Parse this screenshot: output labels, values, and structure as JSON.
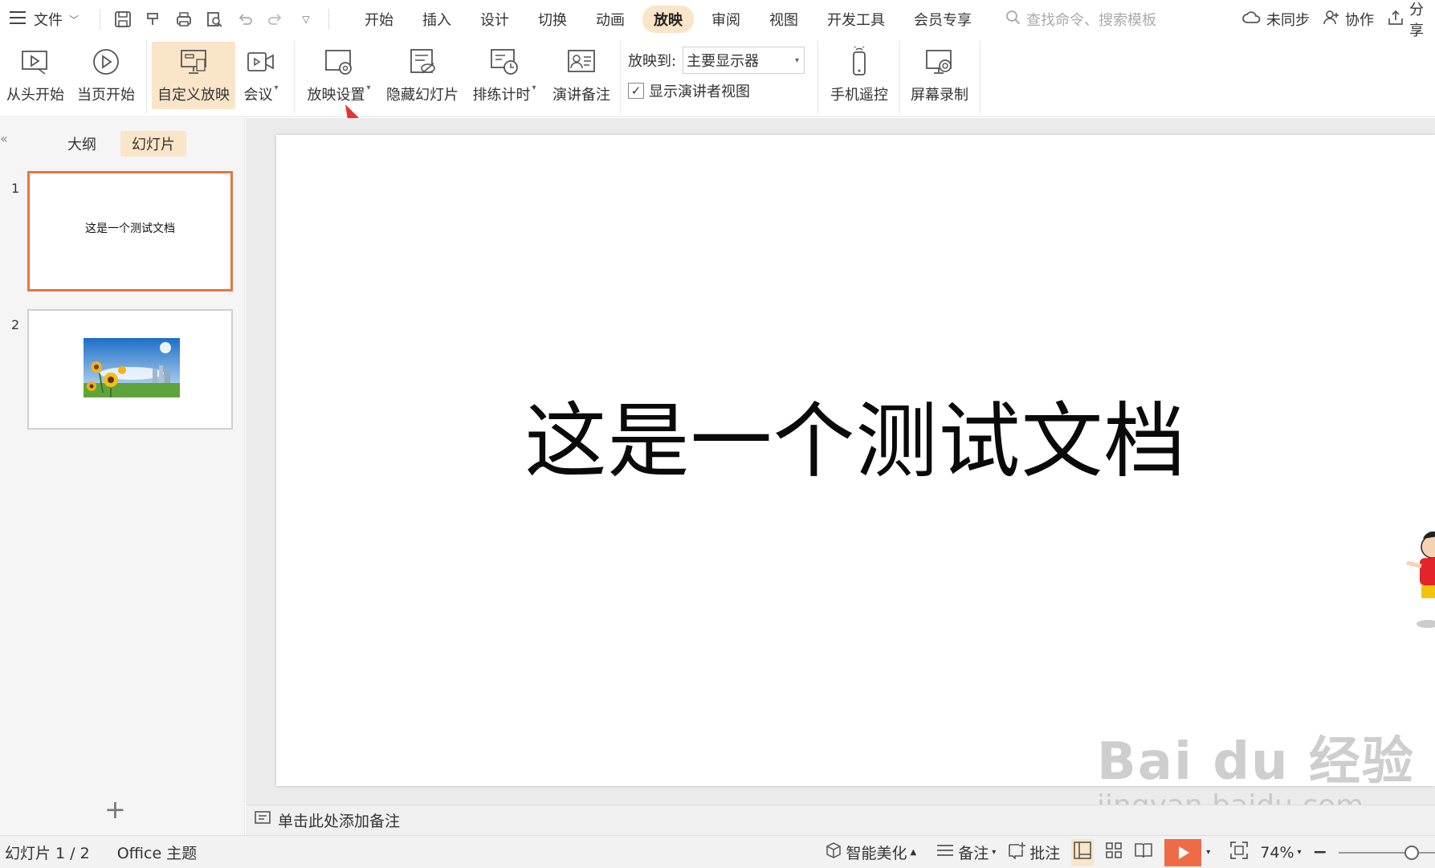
{
  "menubar": {
    "file_label": "文件",
    "tabs": [
      {
        "label": "开始"
      },
      {
        "label": "插入"
      },
      {
        "label": "设计"
      },
      {
        "label": "切换"
      },
      {
        "label": "动画"
      },
      {
        "label": "放映",
        "active": true
      },
      {
        "label": "审阅"
      },
      {
        "label": "视图"
      },
      {
        "label": "开发工具"
      },
      {
        "label": "会员专享"
      }
    ],
    "search_placeholder": "查找命令、搜索模板",
    "sync_label": "未同步",
    "collab_label": "协作",
    "share_label": "分享"
  },
  "ribbon": {
    "from_start": "从头开始",
    "from_current": "当页开始",
    "custom_show": "自定义放映",
    "meeting": "会议",
    "show_settings": "放映设置",
    "hide_slide": "隐藏幻灯片",
    "rehearse": "排练计时",
    "speaker_notes": "演讲备注",
    "play_to_label": "放映到:",
    "play_to_value": "主要显示器",
    "presenter_view_label": "显示演讲者视图",
    "presenter_view_checked": true,
    "remote": "手机遥控",
    "screen_record": "屏幕录制"
  },
  "leftpanel": {
    "tab_outline": "大纲",
    "tab_slides": "幻灯片",
    "slides": [
      {
        "number": "1",
        "text": "这是一个测试文档",
        "selected": true
      },
      {
        "number": "2",
        "text": "",
        "image": "sunflower-city-image"
      }
    ]
  },
  "slide": {
    "title": "这是一个测试文档"
  },
  "notes_placeholder": "单击此处添加备注",
  "statusbar": {
    "slide_count": "幻灯片 1 / 2",
    "theme": "Office 主题",
    "beautify": "智能美化",
    "notes": "备注",
    "comments": "批注",
    "zoom": "74%"
  },
  "watermark": {
    "brand": "Bai du 经验",
    "url": "jingyan.baidu.com"
  },
  "colors": {
    "accent_tab": "#fbe5c8",
    "selected_border": "#e2783e",
    "play_button": "#ef6b47",
    "arrow": "#e8342a"
  }
}
